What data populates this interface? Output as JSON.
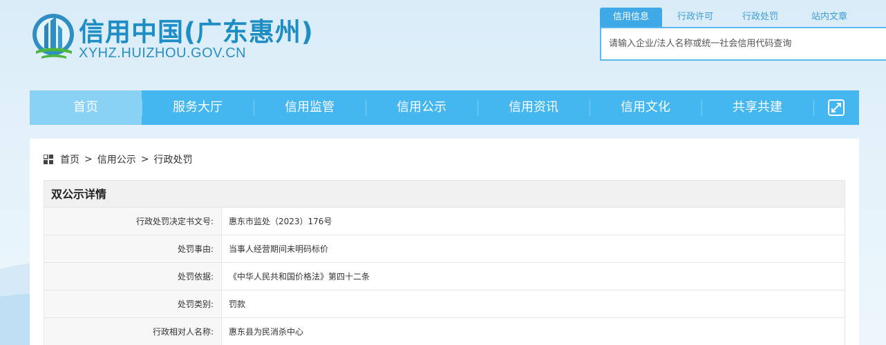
{
  "header": {
    "site_title": "信用中国(广东惠州)",
    "site_domain": "XYHZ.HUIZHOU.GOV.CN"
  },
  "search": {
    "tabs": [
      {
        "label": "信用信息",
        "active": true
      },
      {
        "label": "行政许可",
        "active": false
      },
      {
        "label": "行政处罚",
        "active": false
      },
      {
        "label": "站内文章",
        "active": false
      }
    ],
    "placeholder": "请输入企业/法人名称或统一社会信用代码查询"
  },
  "nav": {
    "items": [
      {
        "label": "首页",
        "active": true
      },
      {
        "label": "服务大厅"
      },
      {
        "label": "信用监管"
      },
      {
        "label": "信用公示"
      },
      {
        "label": "信用资讯"
      },
      {
        "label": "信用文化"
      },
      {
        "label": "共享共建"
      }
    ],
    "expand_icon": "expand-icon"
  },
  "breadcrumb": {
    "items": [
      "首页",
      "信用公示",
      "行政处罚"
    ],
    "separator": ">"
  },
  "detail": {
    "title": "双公示详情",
    "rows": [
      {
        "label": "行政处罚决定书文号:",
        "value": "惠东市监处（2023）176号"
      },
      {
        "label": "处罚事由:",
        "value": "当事人经营期间未明码标价"
      },
      {
        "label": "处罚依据:",
        "value": "《中华人民共和国价格法》第四十二条"
      },
      {
        "label": "处罚类别:",
        "value": "罚款"
      },
      {
        "label": "行政相对人名称:",
        "value": "惠东县为民消杀中心"
      }
    ]
  },
  "colors": {
    "brand": "#1e8dc4",
    "nav_bg": "#44b6f0",
    "nav_active": "#8ad1f6",
    "tab_active": "#3fa9e8"
  }
}
